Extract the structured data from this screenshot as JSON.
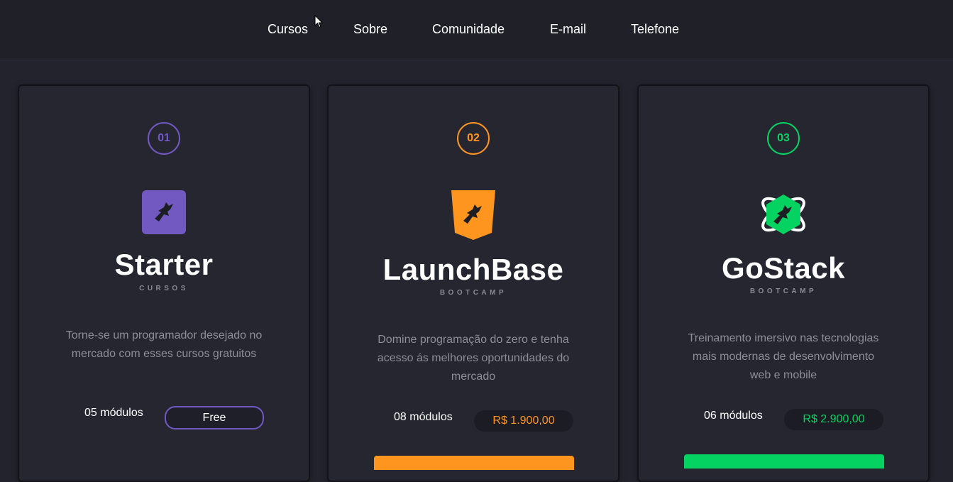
{
  "nav": {
    "items": [
      "Cursos",
      "Sobre",
      "Comunidade",
      "E-mail",
      "Telefone"
    ]
  },
  "cards": [
    {
      "number": "01",
      "title": "Starter",
      "subtitle": "CURSOS",
      "description": "Torne-se um programador desejado no mercado com esses cursos gratuitos",
      "modules": "05 módulos",
      "price": "Free",
      "accent": "#7159c1",
      "logo_icon": "starter-logo-icon"
    },
    {
      "number": "02",
      "title": "LaunchBase",
      "subtitle": "BOOTCAMP",
      "description": "Domine programação do zero e tenha acesso ás melhores oportunidades do mercado",
      "modules": "08 módulos",
      "price": "R$ 1.900,00",
      "accent": "#fd951f",
      "logo_icon": "launchbase-logo-icon"
    },
    {
      "number": "03",
      "title": "GoStack",
      "subtitle": "BOOTCAMP",
      "description": "Treinamento imersivo nas tecnologias mais modernas de desenvolvimento web e mobile",
      "modules": "06 módulos",
      "price": "R$ 2.900,00",
      "accent": "#04d361",
      "logo_icon": "gostack-logo-icon"
    }
  ]
}
